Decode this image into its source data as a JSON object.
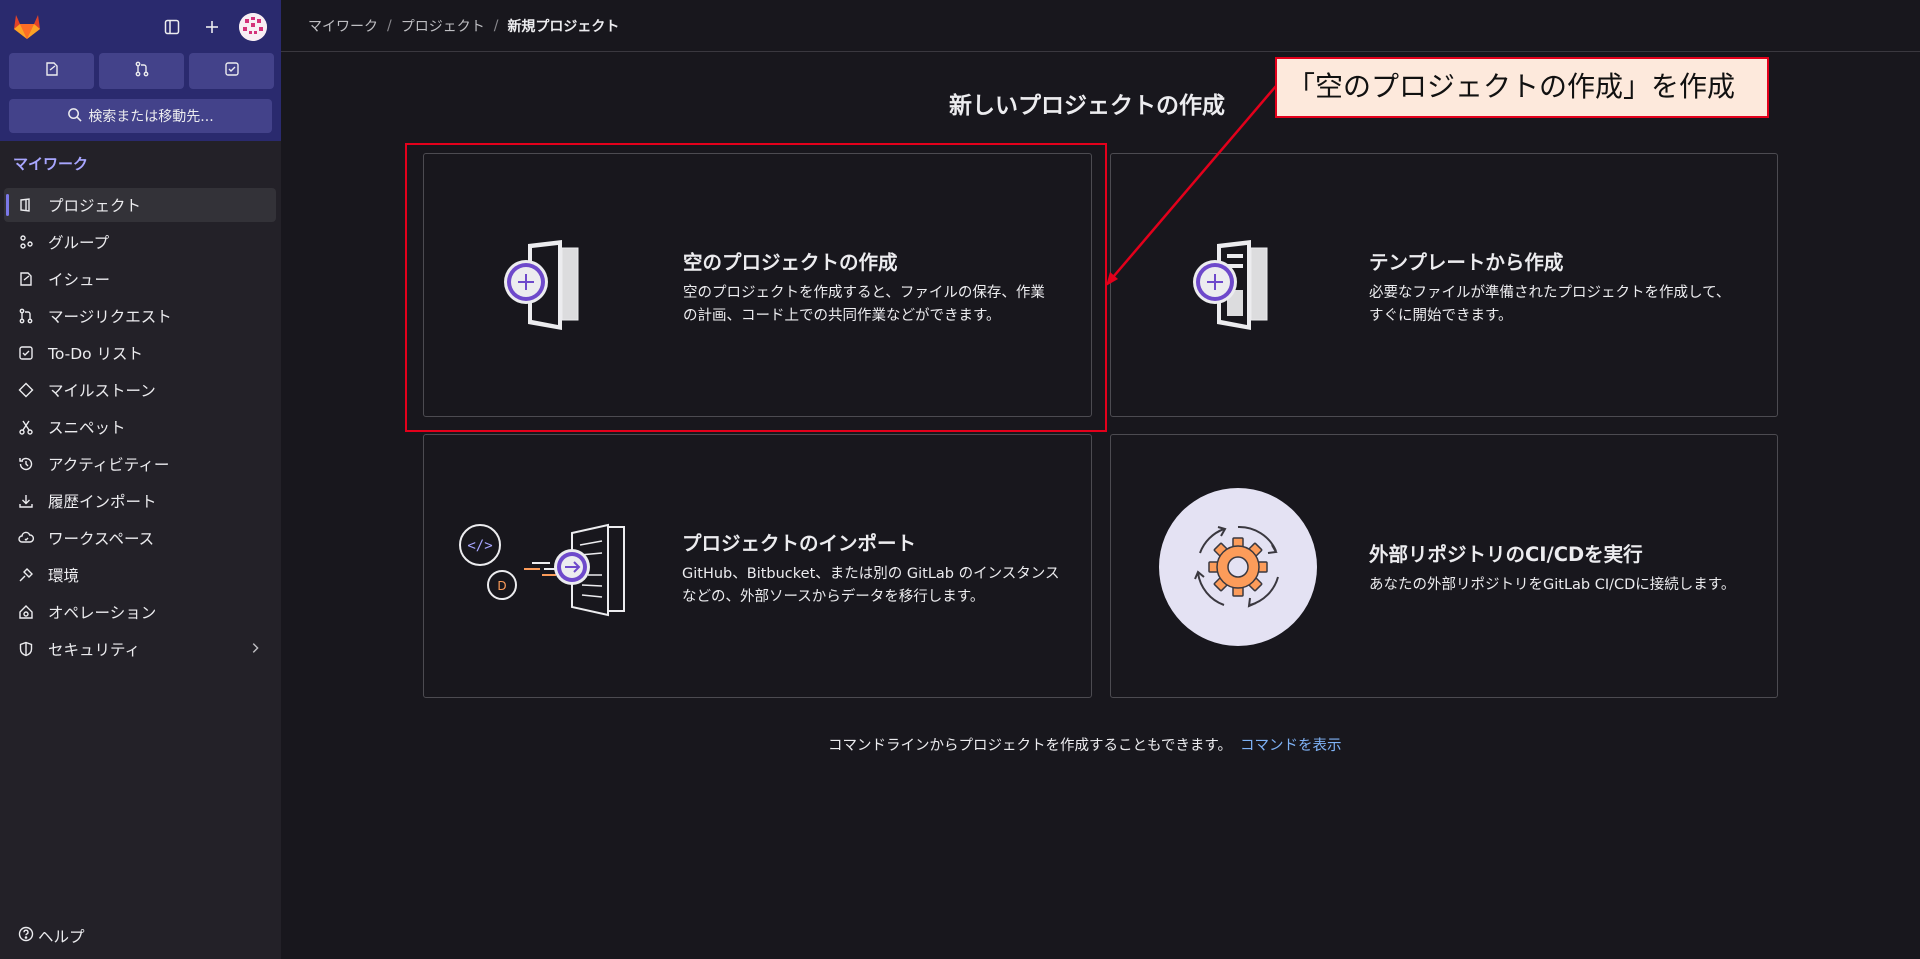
{
  "sidebar": {
    "logo": "gitlab-tanuki-logo",
    "top_icons": [
      "sidebar-toggle-icon",
      "plus-icon",
      "avatar"
    ],
    "quick_actions": [
      "issues-icon",
      "merge-request-icon",
      "todo-icon"
    ],
    "search_label": "検索または移動先...",
    "section_label": "マイワーク",
    "items": [
      {
        "label": "プロジェクト",
        "icon": "project-icon",
        "active": true
      },
      {
        "label": "グループ",
        "icon": "group-icon"
      },
      {
        "label": "イシュー",
        "icon": "issues-icon"
      },
      {
        "label": "マージリクエスト",
        "icon": "merge-request-icon"
      },
      {
        "label": "To-Do リスト",
        "icon": "todo-icon"
      },
      {
        "label": "マイルストーン",
        "icon": "milestone-icon"
      },
      {
        "label": "スニペット",
        "icon": "snippet-icon"
      },
      {
        "label": "アクティビティー",
        "icon": "history-icon"
      },
      {
        "label": "履歴インポート",
        "icon": "download-icon"
      },
      {
        "label": "ワークスペース",
        "icon": "cloud-icon"
      },
      {
        "label": "環境",
        "icon": "environment-icon"
      },
      {
        "label": "オペレーション",
        "icon": "operations-icon"
      },
      {
        "label": "セキュリティ",
        "icon": "shield-icon",
        "has_chevron": true
      }
    ],
    "help_label": "ヘルプ"
  },
  "breadcrumb": [
    "マイワーク",
    "プロジェクト",
    "新規プロジェクト"
  ],
  "page_title": "新しいプロジェクトの作成",
  "cards": [
    {
      "title": "空のプロジェクトの作成",
      "desc_line1": "空のプロジェクトを作成すると、ファイルの保存、作業",
      "desc_line2": "の計画、コード上での共同作業などができます。",
      "icon": "blank-project-illustration"
    },
    {
      "title": "テンプレートから作成",
      "desc_line1": "必要なファイルが準備されたプロジェクトを作成して、",
      "desc_line2": "すぐに開始できます。",
      "icon": "template-project-illustration"
    },
    {
      "title": "プロジェクトのインポート",
      "desc_line1": "GitHub、Bitbucket、または別の GitLab のインスタンス",
      "desc_line2": "などの、外部ソースからデータを移行します。",
      "icon": "import-project-illustration"
    },
    {
      "title": "外部リポジトリのCI/CDを実行",
      "desc_line1": "あなたの外部リポジトリをGitLab CI/CDに接続します。",
      "desc_line2": "",
      "icon": "cicd-gear-illustration"
    }
  ],
  "footer": {
    "text": "コマンドラインからプロジェクトを作成することもできます。",
    "link": "コマンドを表示"
  },
  "annotation": {
    "callout": "「空のプロジェクトの作成」を作成",
    "color": "#e3001b"
  },
  "colors": {
    "sidebar_top": "#2a2a6e",
    "accent": "#a8a6ff",
    "link": "#7fb2f5",
    "background": "#18171d"
  }
}
